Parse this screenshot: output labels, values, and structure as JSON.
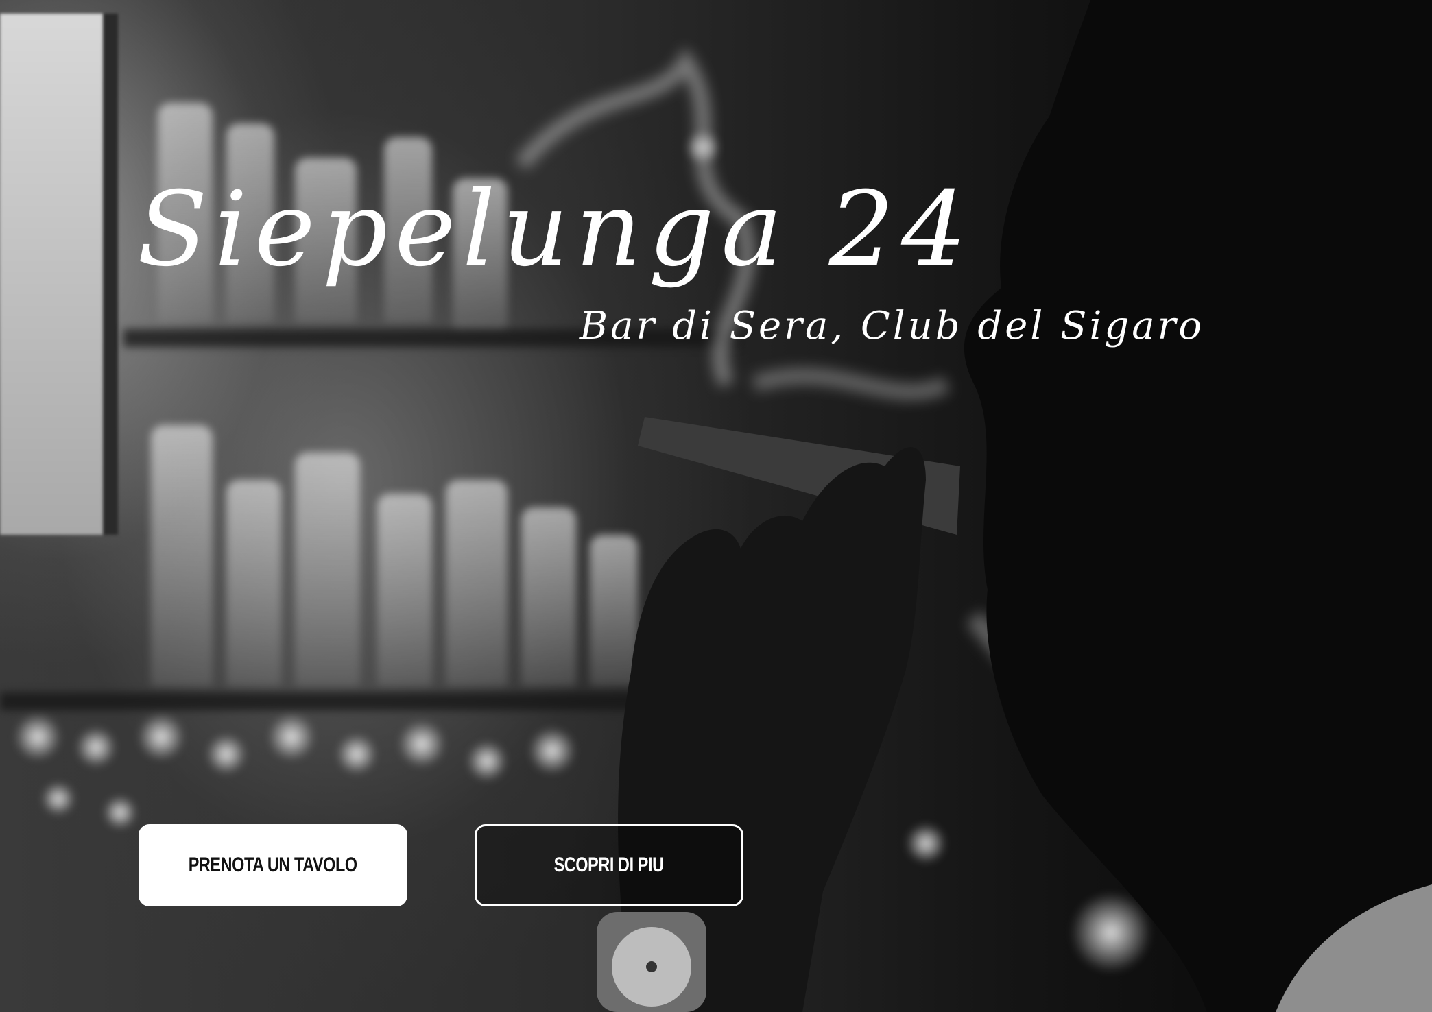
{
  "hero": {
    "title": "Siepelunga 24",
    "subtitle": "Bar di Sera, Club del Sigaro"
  },
  "actions": {
    "primary_label": "PRENOTA UN TAVOLO",
    "secondary_label": "SCOPRI DI PIU"
  },
  "colors": {
    "text": "#ffffff",
    "primary_button_bg": "#ffffff",
    "primary_button_text": "#111111",
    "secondary_button_border": "#ffffff"
  }
}
